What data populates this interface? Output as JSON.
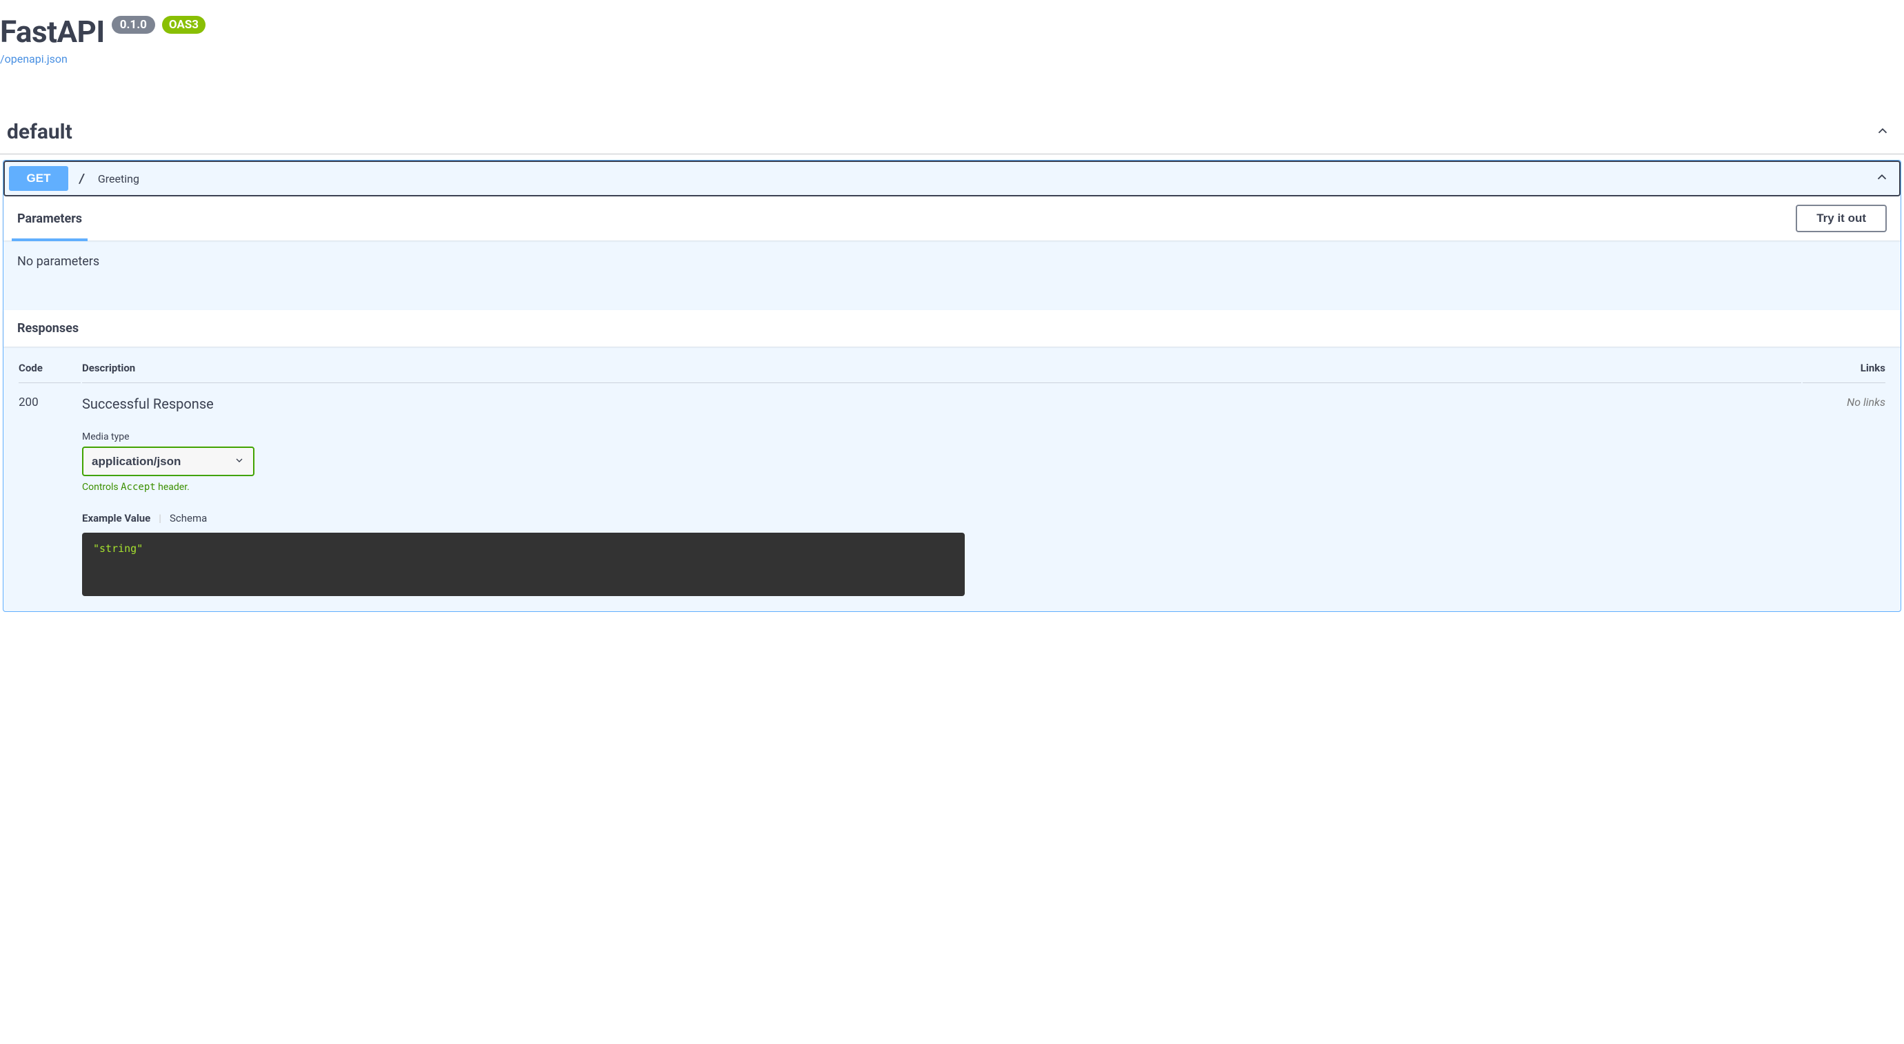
{
  "header": {
    "title": "FastAPI",
    "version": "0.1.0",
    "oas_label": "OAS3",
    "openapi_link": "/openapi.json"
  },
  "tag": {
    "name": "default"
  },
  "operation": {
    "method": "GET",
    "path": "/",
    "summary": "Greeting",
    "parameters_tab": "Parameters",
    "try_it_out": "Try it out",
    "no_parameters": "No parameters",
    "responses_label": "Responses"
  },
  "responses_table": {
    "col_code": "Code",
    "col_description": "Description",
    "col_links": "Links"
  },
  "response": {
    "code": "200",
    "description": "Successful Response",
    "media_type_label": "Media type",
    "media_type_value": "application/json",
    "accept_note_prefix": "Controls ",
    "accept_note_mono": "Accept",
    "accept_note_suffix": " header.",
    "tab_example": "Example Value",
    "tab_schema": "Schema",
    "example_body": "\"string\"",
    "no_links": "No links"
  }
}
